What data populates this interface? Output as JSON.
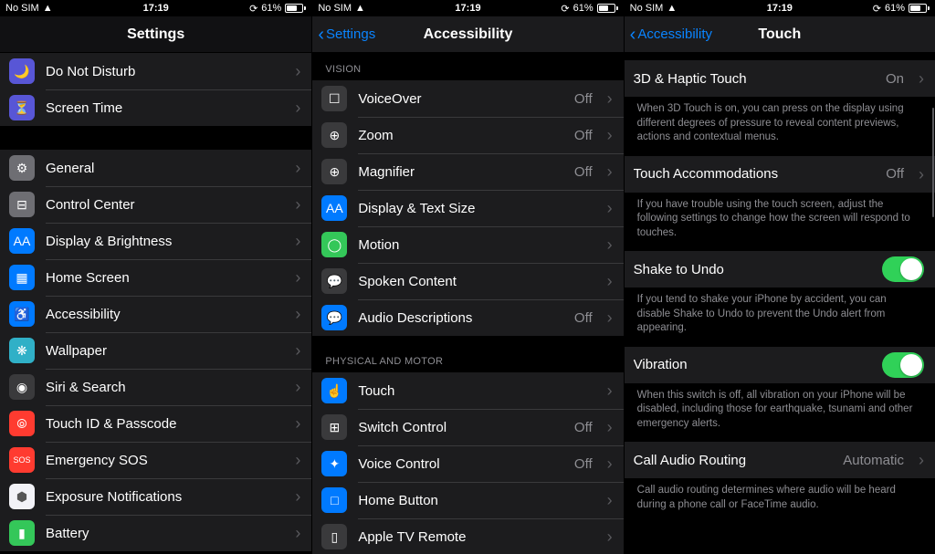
{
  "status": {
    "carrier": "No SIM",
    "time": "17:19",
    "battery": "61%"
  },
  "screen1": {
    "title": "Settings",
    "group1": [
      {
        "label": "Do Not Disturb",
        "icon": "🌙",
        "bg": "ic-purple"
      },
      {
        "label": "Screen Time",
        "icon": "⏳",
        "bg": "ic-purple"
      }
    ],
    "group2": [
      {
        "label": "General",
        "icon": "⚙",
        "bg": "ic-gray"
      },
      {
        "label": "Control Center",
        "icon": "⊟",
        "bg": "ic-gray"
      },
      {
        "label": "Display & Brightness",
        "icon": "AA",
        "bg": "ic-blue"
      },
      {
        "label": "Home Screen",
        "icon": "▦",
        "bg": "ic-blue"
      },
      {
        "label": "Accessibility",
        "icon": "♿",
        "bg": "ic-blue"
      },
      {
        "label": "Wallpaper",
        "icon": "❋",
        "bg": "ic-teal"
      },
      {
        "label": "Siri & Search",
        "icon": "◉",
        "bg": "ic-dark"
      },
      {
        "label": "Touch ID & Passcode",
        "icon": "⦾",
        "bg": "ic-red"
      },
      {
        "label": "Emergency SOS",
        "icon": "SOS",
        "bg": "ic-red"
      },
      {
        "label": "Exposure Notifications",
        "icon": "⬢",
        "bg": "ic-white"
      },
      {
        "label": "Battery",
        "icon": "▮",
        "bg": "ic-green"
      }
    ]
  },
  "screen2": {
    "back": "Settings",
    "title": "Accessibility",
    "sections": {
      "vision_header": "VISION",
      "vision": [
        {
          "label": "VoiceOver",
          "detail": "Off",
          "icon": "☐",
          "bg": "ic-dark"
        },
        {
          "label": "Zoom",
          "detail": "Off",
          "icon": "⊕",
          "bg": "ic-dark"
        },
        {
          "label": "Magnifier",
          "detail": "Off",
          "icon": "⊕",
          "bg": "ic-dark"
        },
        {
          "label": "Display & Text Size",
          "detail": "",
          "icon": "AA",
          "bg": "ic-blue"
        },
        {
          "label": "Motion",
          "detail": "",
          "icon": "◯",
          "bg": "ic-green"
        },
        {
          "label": "Spoken Content",
          "detail": "",
          "icon": "💬",
          "bg": "ic-dark"
        },
        {
          "label": "Audio Descriptions",
          "detail": "Off",
          "icon": "💬",
          "bg": "ic-blue"
        }
      ],
      "motor_header": "PHYSICAL AND MOTOR",
      "motor": [
        {
          "label": "Touch",
          "detail": "",
          "icon": "☝",
          "bg": "ic-blue"
        },
        {
          "label": "Switch Control",
          "detail": "Off",
          "icon": "⊞",
          "bg": "ic-dark"
        },
        {
          "label": "Voice Control",
          "detail": "Off",
          "icon": "✦",
          "bg": "ic-blue"
        },
        {
          "label": "Home Button",
          "detail": "",
          "icon": "□",
          "bg": "ic-blue"
        },
        {
          "label": "Apple TV Remote",
          "detail": "",
          "icon": "▯",
          "bg": "ic-dark"
        }
      ]
    }
  },
  "screen3": {
    "back": "Accessibility",
    "title": "Touch",
    "rows": {
      "haptic": {
        "label": "3D & Haptic Touch",
        "detail": "On"
      },
      "haptic_footer": "When 3D Touch is on, you can press on the display using different degrees of pressure to reveal content previews, actions and contextual menus.",
      "accom": {
        "label": "Touch Accommodations",
        "detail": "Off"
      },
      "accom_footer": "If you have trouble using the touch screen, adjust the following settings to change how the screen will respond to touches.",
      "shake": {
        "label": "Shake to Undo",
        "on": true
      },
      "shake_footer": "If you tend to shake your iPhone by accident, you can disable Shake to Undo to prevent the Undo alert from appearing.",
      "vibration": {
        "label": "Vibration",
        "on": true
      },
      "vibration_footer": "When this switch is off, all vibration on your iPhone will be disabled, including those for earthquake, tsunami and other emergency alerts.",
      "audio": {
        "label": "Call Audio Routing",
        "detail": "Automatic"
      },
      "audio_footer": "Call audio routing determines where audio will be heard during a phone call or FaceTime audio."
    }
  }
}
